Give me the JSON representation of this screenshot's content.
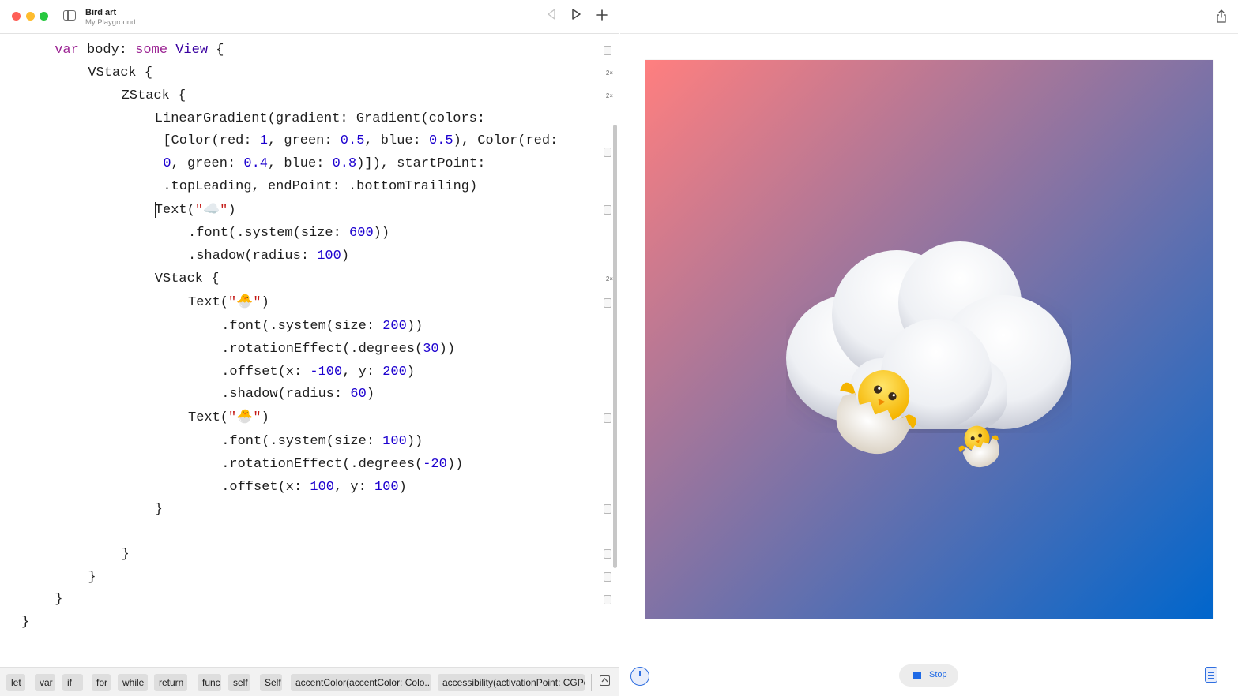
{
  "window": {
    "title": "Bird art",
    "subtitle": "My Playground"
  },
  "code_lines": [
    [
      {
        "t": "var",
        "k": "kw"
      },
      {
        "t": " body: "
      },
      {
        "t": "some",
        "k": "kw"
      },
      {
        "t": " "
      },
      {
        "t": "View",
        "k": "typ"
      },
      {
        "t": " {"
      }
    ],
    [
      {
        "t": "VStack {"
      }
    ],
    [
      {
        "t": "ZStack {"
      }
    ],
    [
      {
        "t": "LinearGradient(gradient: Gradient(colors:"
      }
    ],
    [
      {
        "t": "[Color(red: "
      },
      {
        "t": "1",
        "k": "num"
      },
      {
        "t": ", green: "
      },
      {
        "t": "0.5",
        "k": "num"
      },
      {
        "t": ", blue: "
      },
      {
        "t": "0.5",
        "k": "num"
      },
      {
        "t": "), Color(red:"
      }
    ],
    [
      {
        "t": "0",
        "k": "num"
      },
      {
        "t": ", green: "
      },
      {
        "t": "0.4",
        "k": "num"
      },
      {
        "t": ", blue: "
      },
      {
        "t": "0.8",
        "k": "num"
      },
      {
        "t": ")]), startPoint:"
      }
    ],
    [
      {
        "t": ".topLeading, endPoint: .bottomTrailing)"
      }
    ],
    [
      {
        "t": "Text("
      },
      {
        "t": "\"☁️\"",
        "k": "str"
      },
      {
        "t": ")"
      }
    ],
    [
      {
        "t": ".font(.system(size: "
      },
      {
        "t": "600",
        "k": "num"
      },
      {
        "t": "))"
      }
    ],
    [
      {
        "t": ".shadow(radius: "
      },
      {
        "t": "100",
        "k": "num"
      },
      {
        "t": ")"
      }
    ],
    [
      {
        "t": "VStack {"
      }
    ],
    [
      {
        "t": "Text("
      },
      {
        "t": "\"🐣\"",
        "k": "str"
      },
      {
        "t": ")"
      }
    ],
    [
      {
        "t": ".font(.system(size: "
      },
      {
        "t": "200",
        "k": "num"
      },
      {
        "t": "))"
      }
    ],
    [
      {
        "t": ".rotationEffect(.degrees("
      },
      {
        "t": "30",
        "k": "num"
      },
      {
        "t": "))"
      }
    ],
    [
      {
        "t": ".offset(x: "
      },
      {
        "t": "-100",
        "k": "num"
      },
      {
        "t": ", y: "
      },
      {
        "t": "200",
        "k": "num"
      },
      {
        "t": ")"
      }
    ],
    [
      {
        "t": ".shadow(radius: "
      },
      {
        "t": "60",
        "k": "num"
      },
      {
        "t": ")"
      }
    ],
    [
      {
        "t": "Text("
      },
      {
        "t": "\"🐣\"",
        "k": "str"
      },
      {
        "t": ")"
      }
    ],
    [
      {
        "t": ".font(.system(size: "
      },
      {
        "t": "100",
        "k": "num"
      },
      {
        "t": "))"
      }
    ],
    [
      {
        "t": ".rotationEffect(.degrees("
      },
      {
        "t": "-20",
        "k": "num"
      },
      {
        "t": "))"
      }
    ],
    [
      {
        "t": ".offset(x: "
      },
      {
        "t": "100",
        "k": "num"
      },
      {
        "t": ", y: "
      },
      {
        "t": "100",
        "k": "num"
      },
      {
        "t": ")"
      }
    ],
    [
      {
        "t": "}"
      }
    ],
    [
      {
        "t": "}"
      }
    ],
    [
      {
        "t": "}"
      }
    ],
    [
      {
        "t": "}"
      }
    ],
    [
      {
        "t": "}"
      }
    ]
  ],
  "result_counts": {
    "vstack_outer": "2×",
    "zstack": "2×",
    "vstack_inner": "2×"
  },
  "suggestions": [
    "let",
    "var",
    "if",
    "for",
    "while",
    "return",
    "func",
    "self",
    "Self",
    "accentColor(accentColor: Colo...",
    "accessibility(activationPoint: CGPo"
  ],
  "live_view": {
    "stop_label": "Stop",
    "gradient_colors": [
      "#ff7f7f",
      "#0066cc"
    ]
  },
  "icons": {
    "sidebar": "sidebar-icon",
    "back": "back-icon",
    "run": "play-icon",
    "add": "plus-icon",
    "share": "share-icon",
    "speed": "speedometer-icon",
    "stop": "stop-icon",
    "doc": "document-icon",
    "collapse": "collapse-icon"
  }
}
